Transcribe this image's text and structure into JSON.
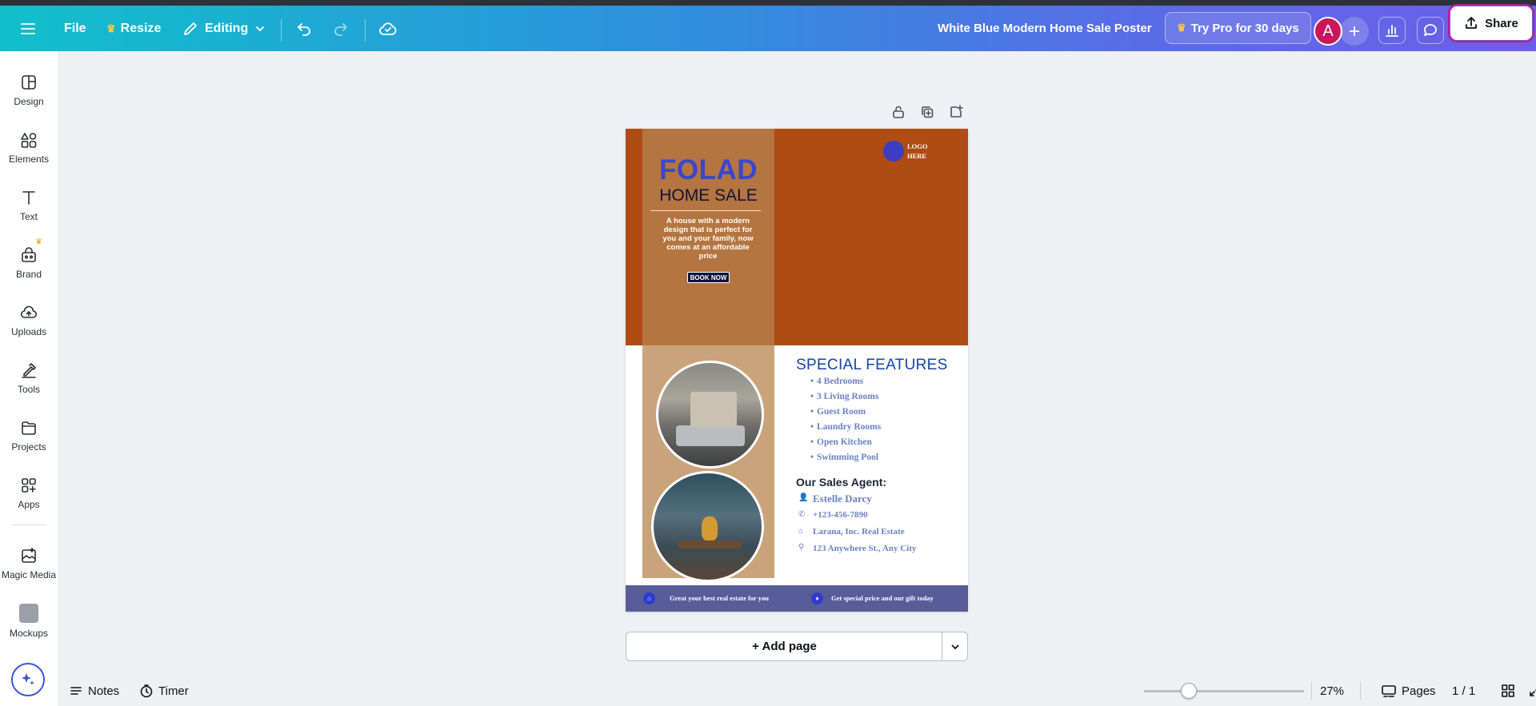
{
  "topbar": {
    "file_label": "File",
    "resize_label": "Resize",
    "editing_label": "Editing",
    "doc_title": "White Blue Modern Home Sale Poster",
    "try_pro_label": "Try Pro for 30 days",
    "avatar_letter": "A",
    "share_label": "Share"
  },
  "sidebar": {
    "items": [
      {
        "label": "Design",
        "icon": "design-icon"
      },
      {
        "label": "Elements",
        "icon": "elements-icon"
      },
      {
        "label": "Text",
        "icon": "text-icon"
      },
      {
        "label": "Brand",
        "icon": "brand-icon"
      },
      {
        "label": "Uploads",
        "icon": "uploads-icon"
      },
      {
        "label": "Tools",
        "icon": "tools-icon"
      },
      {
        "label": "Projects",
        "icon": "projects-icon"
      },
      {
        "label": "Apps",
        "icon": "apps-icon"
      },
      {
        "label": "Magic Media",
        "icon": "magic-media-icon"
      },
      {
        "label": "Mockups",
        "icon": "mockups-icon"
      }
    ]
  },
  "poster": {
    "title": "FOLAD",
    "subtitle": "HOME SALE",
    "description": "A house with a modern design that is perfect for you and your family, now comes at an affordable price",
    "book_now": "BOOK NOW",
    "logo_text": "LOGO HERE",
    "features_title": "SPECIAL FEATURES",
    "features": [
      "4 Bedrooms",
      "3 Living Rooms",
      "Guest Room",
      "Laundry Rooms",
      "Open Kitchen",
      "Swimming Pool"
    ],
    "agent_title": "Our Sales Agent:",
    "agent_name": "Estelle Darcy",
    "agent_phone": "+123-456-7890",
    "agent_company": "Larana, Inc. Real Estate",
    "agent_address": "123 Anywhere St., Any City",
    "footer_left": "Great your best real estate for you",
    "footer_right": "Get special price and our gift today",
    "colors": {
      "rust": "#ae4c14",
      "tan": "#c9a47a",
      "blue": "#3b47c9",
      "navy": "#101437",
      "footer": "#585c99"
    }
  },
  "canvas": {
    "add_page_label": "+ Add page"
  },
  "bottombar": {
    "notes_label": "Notes",
    "timer_label": "Timer",
    "zoom_level": "27%",
    "zoom_fraction": 0.27,
    "pages_label": "Pages",
    "page_count": "1 / 1"
  },
  "accent_colors": {
    "share_outline": "#c2188a",
    "avatar": "#c8175b"
  }
}
